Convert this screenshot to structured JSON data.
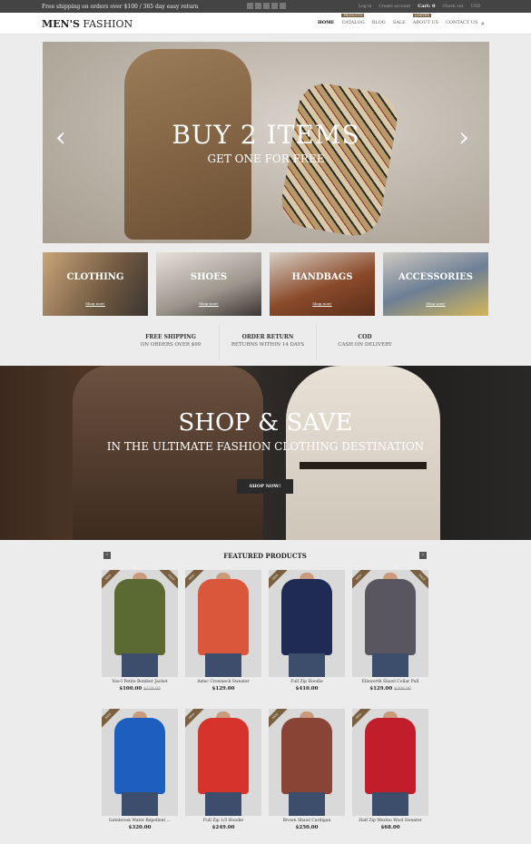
{
  "topbar": {
    "shipping_text": "Free shipping on orders over $100 / 365 day easy return",
    "login": "Log in",
    "create_account": "Create account",
    "cart": "Cart: 0",
    "checkout": "Check out",
    "currency": "USD"
  },
  "header": {
    "logo_bold": "MEN'S",
    "logo_rest": " FASHION",
    "nav": [
      {
        "label": "HOME",
        "badge": ""
      },
      {
        "label": "CATALOG",
        "badge": "PRODUCTS"
      },
      {
        "label": "BLOG",
        "badge": ""
      },
      {
        "label": "SALE",
        "badge": ""
      },
      {
        "label": "ABOUT US",
        "badge": "LIMITED"
      },
      {
        "label": "CONTACT US",
        "badge": ""
      }
    ]
  },
  "hero": {
    "title": "BUY 2 ITEMS",
    "subtitle": "GET ONE FOR FREE"
  },
  "categories": [
    {
      "label": "CLOTHING",
      "link": "Shop now!"
    },
    {
      "label": "SHOES",
      "link": "Shop now!"
    },
    {
      "label": "HANDBAGS",
      "link": "Shop now!"
    },
    {
      "label": "ACCESSORIES",
      "link": "Shop now!"
    }
  ],
  "features": [
    {
      "title": "FREE SHIPPING",
      "sub": "ON ORDERS OVER $99"
    },
    {
      "title": "ORDER RETURN",
      "sub": "RETURNS WITHIN 14 DAYS"
    },
    {
      "title": "COD",
      "sub": "CASH ON DELIVERY"
    }
  ],
  "banner": {
    "title": "SHOP & SAVE",
    "subtitle": "IN THE ULTIMATE FASHION CLOTHING DESTINATION",
    "button": "SHOP NOW!"
  },
  "featured": {
    "title": "FEATURED PRODUCTS",
    "products": [
      {
        "name": "Voo-I Petite Bomber Jacket",
        "price": "$100.00",
        "old_price": "$130.00",
        "color": "#5a6a32",
        "ribbon": "NEW",
        "sale": "SALE"
      },
      {
        "name": "Aztec Crewneck Sweater",
        "price": "$129.00",
        "old_price": "",
        "color": "#d9573a",
        "ribbon": "NEW",
        "sale": ""
      },
      {
        "name": "Full Zip Hoodie",
        "price": "$410.00",
        "old_price": "",
        "color": "#1f2a55",
        "ribbon": "NEW",
        "sale": ""
      },
      {
        "name": "Ellsworth Shawl Collar Pull",
        "price": "$129.00",
        "old_price": "$300.00",
        "color": "#5a5660",
        "ribbon": "NEW",
        "sale": "SALE"
      },
      {
        "name": "Gatebrook Water Repellent ...",
        "price": "$320.00",
        "old_price": "",
        "color": "#1d5fbf",
        "ribbon": "NEW",
        "sale": ""
      },
      {
        "name": "Full Zip 1/3 Hoodie",
        "price": "$249.00",
        "old_price": "",
        "color": "#d6342a",
        "ribbon": "NEW",
        "sale": ""
      },
      {
        "name": "Brown Shawl Cardigan",
        "price": "$250.00",
        "old_price": "",
        "color": "#8a4436",
        "ribbon": "NEW",
        "sale": ""
      },
      {
        "name": "Half Zip Merino Wool Sweater",
        "price": "$68.00",
        "old_price": "",
        "color": "#c21d2a",
        "ribbon": "NEW",
        "sale": ""
      }
    ]
  }
}
